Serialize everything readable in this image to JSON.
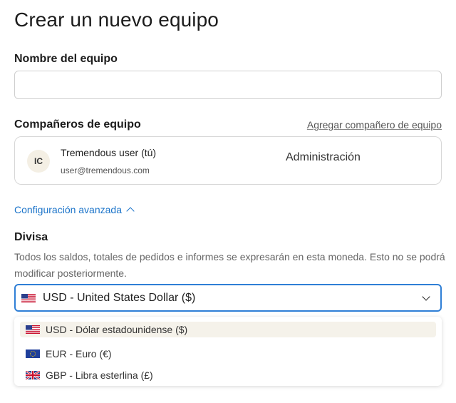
{
  "page": {
    "title": "Crear un nuevo equipo"
  },
  "team_name": {
    "label": "Nombre del equipo",
    "value": "",
    "placeholder": ""
  },
  "teammates": {
    "label": "Compañeros de equipo",
    "add_link": "Agregar compañero de equipo",
    "members": [
      {
        "initials": "IC",
        "name": "Tremendous user (tú)",
        "email": "user@tremendous.com",
        "role": "Administración"
      }
    ]
  },
  "advanced": {
    "label": "Configuración avanzada",
    "icon": "chevron-up-icon",
    "expanded": true
  },
  "currency": {
    "label": "Divisa",
    "help": "Todos los saldos, totales de pedidos e informes se expresarán en esta moneda. Esto no se podrá modificar posteriormente.",
    "selected": {
      "flag": "us-flag-icon",
      "label": "USD - United States Dollar ($)"
    },
    "options": [
      {
        "flag": "us-flag-icon",
        "label": "USD - Dólar estadounidense ($)",
        "highlighted": true
      },
      {
        "flag": "eu-flag-icon",
        "label": "EUR - Euro (€)",
        "highlighted": false
      },
      {
        "flag": "uk-flag-icon",
        "label": "GBP - Libra esterlina (£)",
        "highlighted": false
      }
    ]
  },
  "colors": {
    "accent": "#2f7fd6",
    "link": "#1a73c9",
    "highlight": "#f5f2ea"
  }
}
